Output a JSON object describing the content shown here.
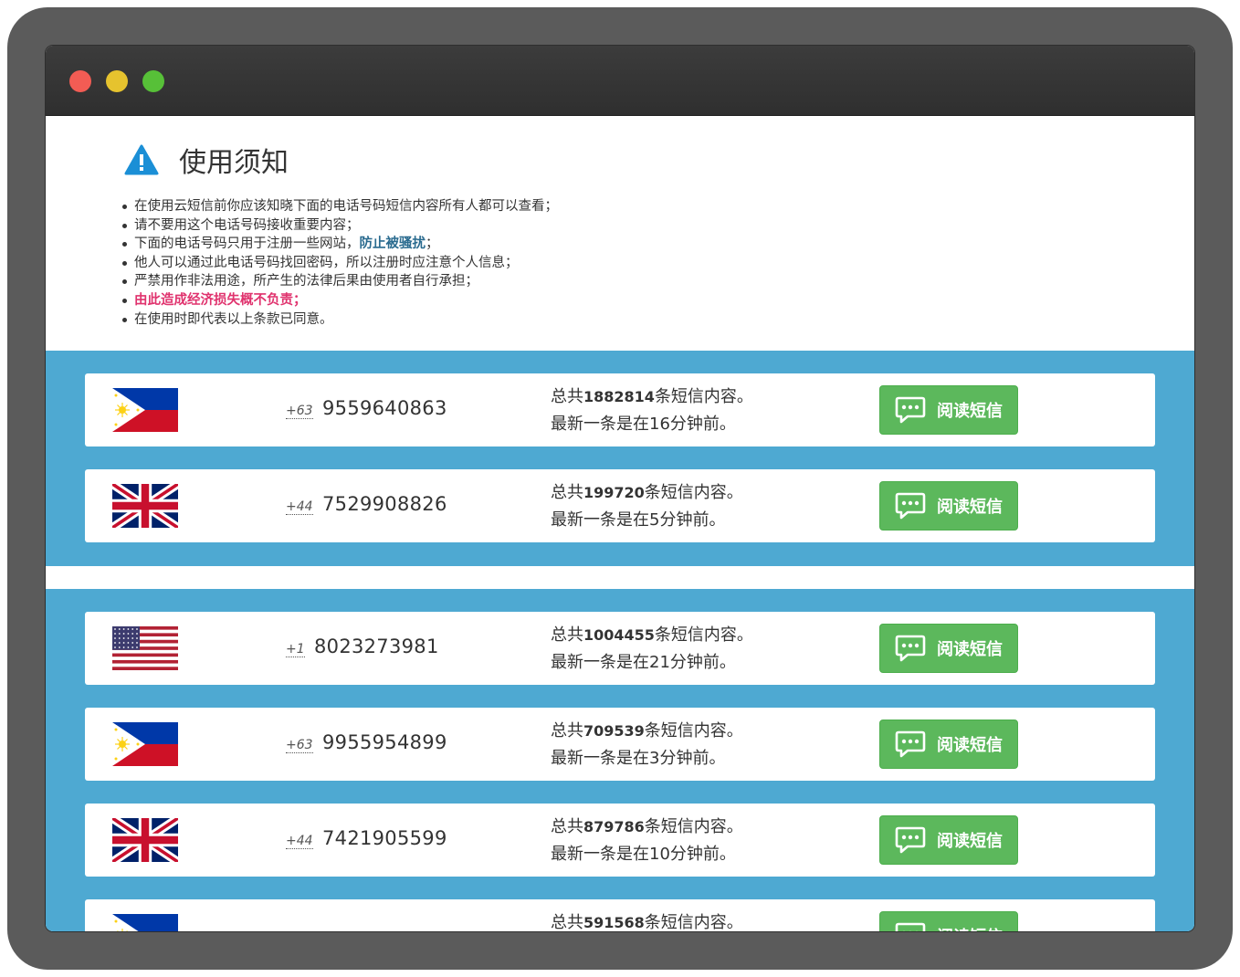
{
  "notice": {
    "title": "使用须知",
    "rules": [
      "在使用云短信前你应该知晓下面的电话号码短信内容所有人都可以查看；",
      "请不要用这个电话号码接收重要内容；",
      "下面的电话号码只用于注册一些网站，",
      "他人可以通过此电话号码找回密码，所以注册时应注意个人信息；",
      "严禁用作非法用途，所产生的法律后果由使用者自行承担；",
      "由此造成经济损失概不负责；",
      "在使用时即代表以上条款已同意。"
    ],
    "rule3_highlight": "防止被骚扰",
    "rule3_tail": "；"
  },
  "labels": {
    "total_prefix": "总共",
    "total_suffix": "条短信内容。",
    "latest_prefix": "最新一条是在",
    "latest_suffix": "钟前。",
    "read_button": "阅读短信"
  },
  "numbers": [
    {
      "flag": "philippines",
      "country_code": "+63",
      "number": "9559640863",
      "total": "1882814",
      "latest": "16分"
    },
    {
      "flag": "uk",
      "country_code": "+44",
      "number": "7529908826",
      "total": "199720",
      "latest": "5分"
    },
    {
      "flag": "usa",
      "country_code": "+1",
      "number": "8023273981",
      "total": "1004455",
      "latest": "21分"
    },
    {
      "flag": "philippines",
      "country_code": "+63",
      "number": "9955954899",
      "total": "709539",
      "latest": "3分"
    },
    {
      "flag": "uk",
      "country_code": "+44",
      "number": "7421905599",
      "total": "879786",
      "latest": "10分"
    },
    {
      "flag": "philippines",
      "country_code": "",
      "number": "",
      "total": "591568",
      "latest": ""
    }
  ],
  "colors": {
    "block_bg": "#4ea9d2",
    "button_green": "#5cb85c",
    "highlight_blue": "#2a6b8f",
    "warning_pink": "#e0336e",
    "warning_icon": "#1b8fd6"
  }
}
